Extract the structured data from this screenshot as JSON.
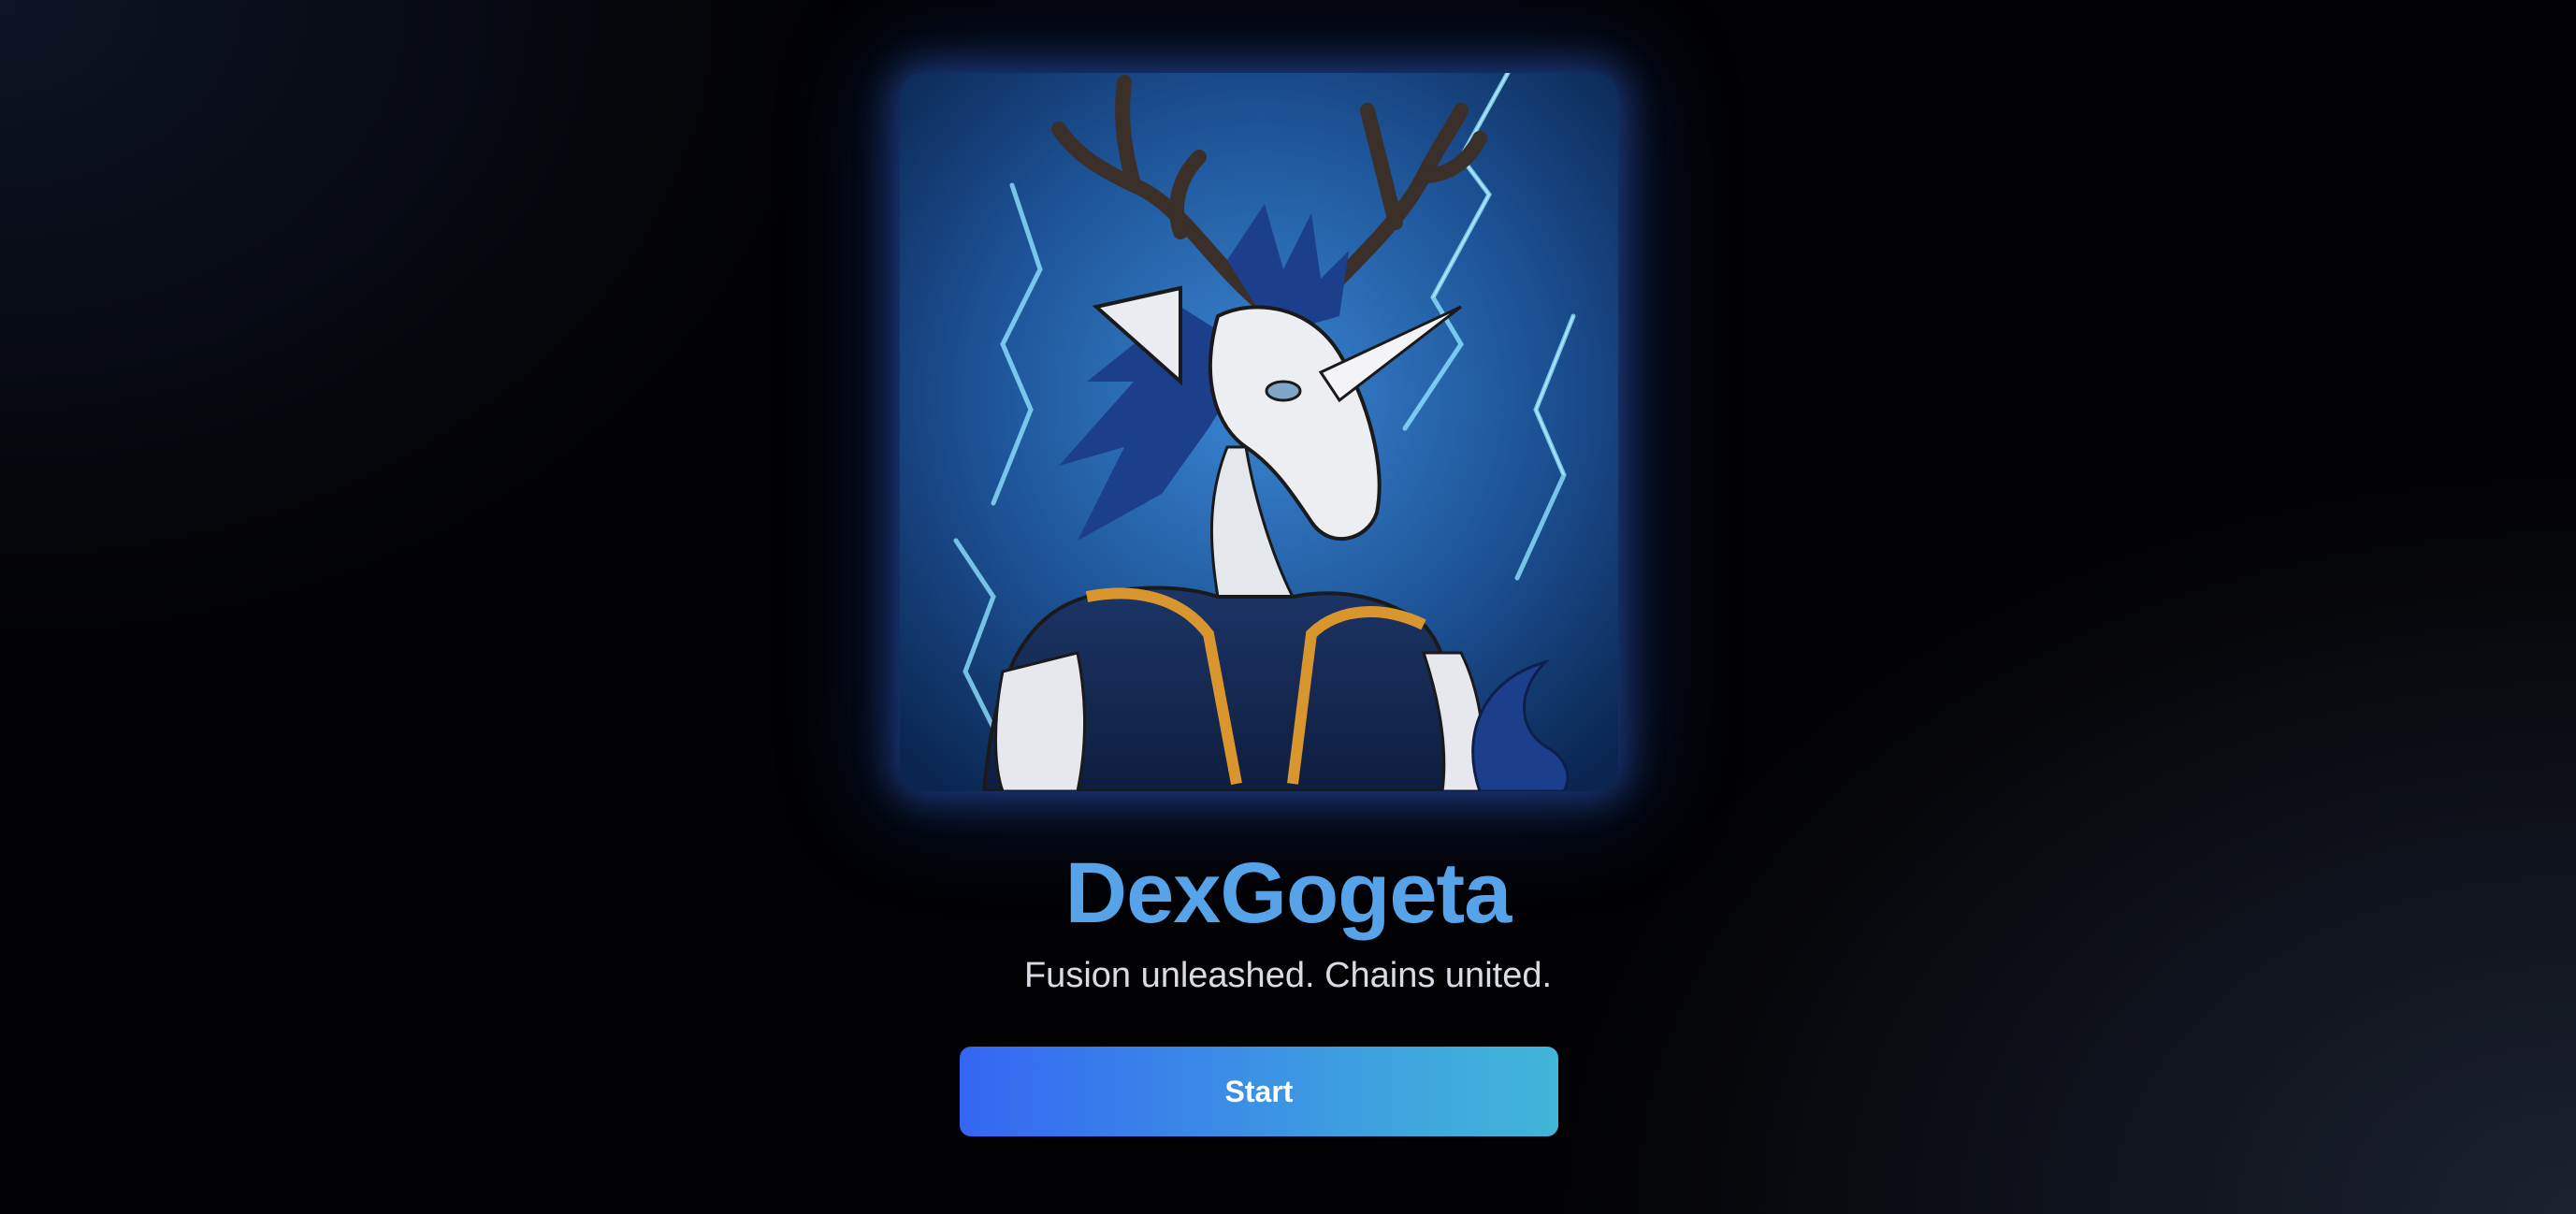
{
  "app": {
    "title": "DexGogeta",
    "tagline": "Fusion unleashed. Chains united."
  },
  "hero_image": {
    "subject": "anime-style white unicorn-stag warrior with dark antlers and blue mane, wearing a navy gi with gold trim, against blue lightning background"
  },
  "actions": {
    "start_label": "Start"
  },
  "colors": {
    "title": "#56a3ea",
    "button_gradient_start": "#3466f3",
    "button_gradient_end": "#40b6d8",
    "glow": "#376ee6",
    "background": "#020204"
  }
}
